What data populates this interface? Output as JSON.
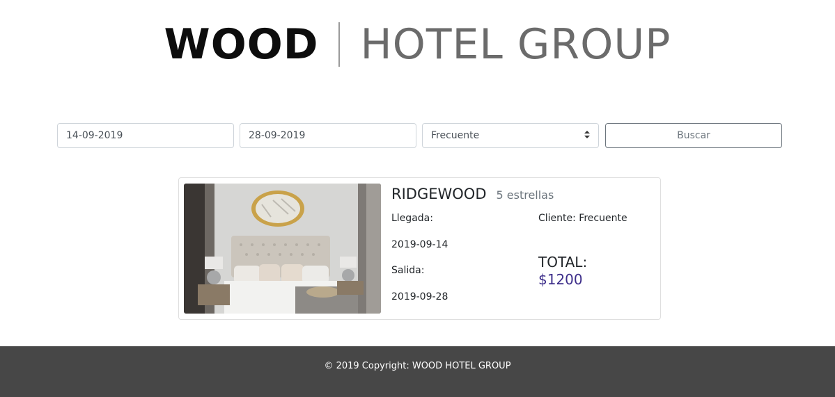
{
  "logo": {
    "primary": "WOOD",
    "secondary": "HOTEL GROUP"
  },
  "search": {
    "checkin_value": "14-09-2019",
    "checkout_value": "28-09-2019",
    "client_type_selected": "Frecuente",
    "search_button_label": "Buscar"
  },
  "hotel": {
    "name": "RIDGEWOOD",
    "stars": "5 estrellas",
    "checkin_label": "Llegada:",
    "checkin_date": "2019-09-14",
    "checkout_label": "Salida:",
    "checkout_date": "2019-09-28",
    "client": "Cliente: Frecuente",
    "total_label": "TOTAL:",
    "total_value": "$1200",
    "image_icon": "hotel-room-photo"
  },
  "footer": {
    "copyright": "© 2019 Copyright: WOOD HOTEL GROUP"
  },
  "colors": {
    "footer_bg": "#474747",
    "total_accent": "#3d2e8a",
    "button_border": "#6c757d"
  }
}
